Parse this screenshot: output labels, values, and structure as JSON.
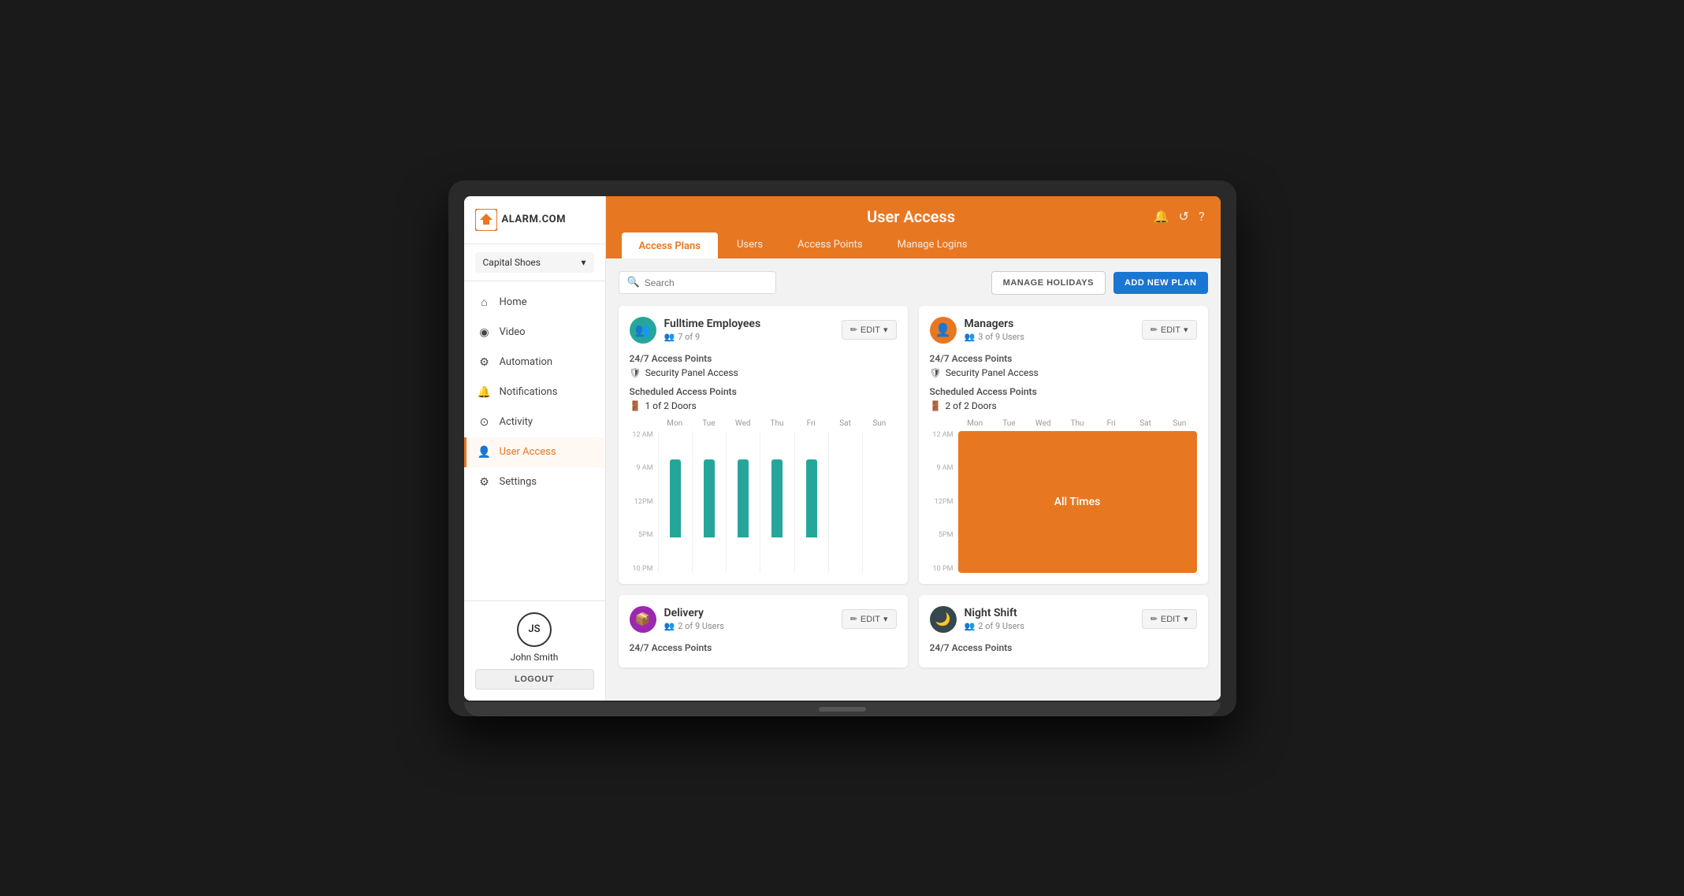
{
  "brand": {
    "name": "ALARM.COM",
    "logo_symbol": "⌂"
  },
  "account": {
    "name": "Capital Shoes"
  },
  "header": {
    "title": "User Access",
    "icons": [
      "🔔",
      "↺",
      "?"
    ],
    "tabs": [
      {
        "label": "Access Plans",
        "active": true
      },
      {
        "label": "Users",
        "active": false
      },
      {
        "label": "Access Points",
        "active": false
      },
      {
        "label": "Manage Logins",
        "active": false
      }
    ]
  },
  "toolbar": {
    "search_placeholder": "Search",
    "manage_holidays_label": "MANAGE HOLIDAYS",
    "add_new_plan_label": "ADD NEW PLAN"
  },
  "sidebar": {
    "nav_items": [
      {
        "label": "Home",
        "icon": "⌂",
        "active": false
      },
      {
        "label": "Video",
        "icon": "▶",
        "active": false
      },
      {
        "label": "Automation",
        "icon": "⚡",
        "active": false
      },
      {
        "label": "Notifications",
        "icon": "🔔",
        "active": false
      },
      {
        "label": "Activity",
        "icon": "⊙",
        "active": false
      },
      {
        "label": "User Access",
        "icon": "👤",
        "active": true
      },
      {
        "label": "Settings",
        "icon": "⚙",
        "active": false
      }
    ]
  },
  "user": {
    "initials": "JS",
    "name": "John Smith",
    "logout_label": "LOGOUT"
  },
  "cards": [
    {
      "id": "fulltime-employees",
      "title": "Fulltime Employees",
      "users": "7 of 9",
      "icon_type": "teal",
      "icon": "👥",
      "access_247_label": "24/7 Access Points",
      "security_label": "Security Panel Access",
      "scheduled_label": "Scheduled Access Points",
      "doors_label": "1 of 2 Doors",
      "chart_type": "bars",
      "bars": [
        {
          "day": "Mon",
          "top_pct": 20,
          "height_pct": 55
        },
        {
          "day": "Tue",
          "top_pct": 20,
          "height_pct": 55
        },
        {
          "day": "Wed",
          "top_pct": 20,
          "height_pct": 55
        },
        {
          "day": "Thu",
          "top_pct": 20,
          "height_pct": 55
        },
        {
          "day": "Fri",
          "top_pct": 20,
          "height_pct": 55
        },
        {
          "day": "Sat",
          "top_pct": 0,
          "height_pct": 0
        },
        {
          "day": "Sun",
          "top_pct": 0,
          "height_pct": 0
        }
      ]
    },
    {
      "id": "managers",
      "title": "Managers",
      "users": "3 of 9 Users",
      "icon_type": "orange",
      "icon": "👤",
      "access_247_label": "24/7 Access Points",
      "security_label": "Security Panel Access",
      "scheduled_label": "Scheduled Access Points",
      "doors_label": "2 of 2 Doors",
      "chart_type": "all_times",
      "all_times_text": "All Times"
    },
    {
      "id": "delivery",
      "title": "Delivery",
      "users": "2 of 9 Users",
      "icon_type": "purple",
      "icon": "📦",
      "access_247_label": "24/7 Access Points",
      "security_label": "",
      "scheduled_label": "",
      "doors_label": "",
      "chart_type": "none"
    },
    {
      "id": "night-shift",
      "title": "Night Shift",
      "users": "2 of 9 Users",
      "icon_type": "dark",
      "icon": "🌙",
      "access_247_label": "24/7 Access Points",
      "security_label": "",
      "scheduled_label": "",
      "doors_label": "",
      "chart_type": "none"
    }
  ]
}
